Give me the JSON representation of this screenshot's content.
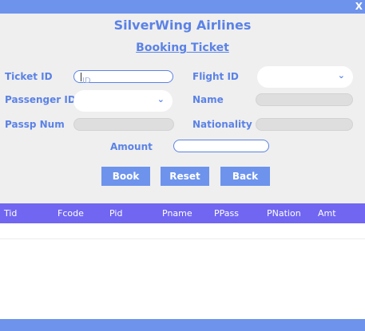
{
  "window": {
    "close_label": "X"
  },
  "header": {
    "title": "SilverWing Airlines",
    "subtitle": "Booking Ticket"
  },
  "form": {
    "ticket_id_label": "Ticket ID",
    "ticket_id_placeholder": "ID",
    "flight_id_label": "Flight ID",
    "passenger_id_label": "Passenger ID",
    "name_label": "Name",
    "passp_num_label": "Passp Num",
    "nationality_label": "Nationality",
    "amount_label": "Amount"
  },
  "buttons": {
    "book": "Book",
    "reset": "Reset",
    "back": "Back"
  },
  "table": {
    "columns": [
      "Tid",
      "Fcode",
      "Pid",
      "Pname",
      "PPass",
      "PNation",
      "Amt"
    ],
    "rows": []
  },
  "colors": {
    "accent": "#5b82e6",
    "button": "#6d93ec",
    "table_header": "#7166f1",
    "background": "#efefef"
  },
  "icons": {
    "dropdown": "chevron-down-icon",
    "close": "close-icon"
  }
}
